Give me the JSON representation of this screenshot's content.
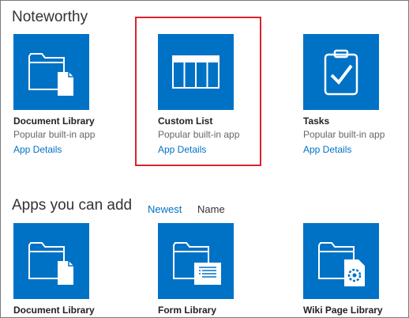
{
  "noteworthy": {
    "title": "Noteworthy",
    "tiles": [
      {
        "name": "Document Library",
        "desc": "Popular built-in app",
        "details": "App Details",
        "icon": "document-library-icon"
      },
      {
        "name": "Custom List",
        "desc": "Popular built-in app",
        "details": "App Details",
        "icon": "custom-list-icon"
      },
      {
        "name": "Tasks",
        "desc": "Popular built-in app",
        "details": "App Details",
        "icon": "tasks-icon"
      }
    ]
  },
  "apps": {
    "title": "Apps you can add",
    "sort": {
      "newest": "Newest",
      "name": "Name"
    },
    "tiles": [
      {
        "name": "Document Library",
        "icon": "document-library-icon"
      },
      {
        "name": "Form Library",
        "icon": "form-library-icon"
      },
      {
        "name": "Wiki Page Library",
        "icon": "wiki-page-library-icon"
      }
    ]
  },
  "colors": {
    "tile": "#0072c6",
    "link": "#0072c6",
    "highlight": "#d9232e"
  }
}
